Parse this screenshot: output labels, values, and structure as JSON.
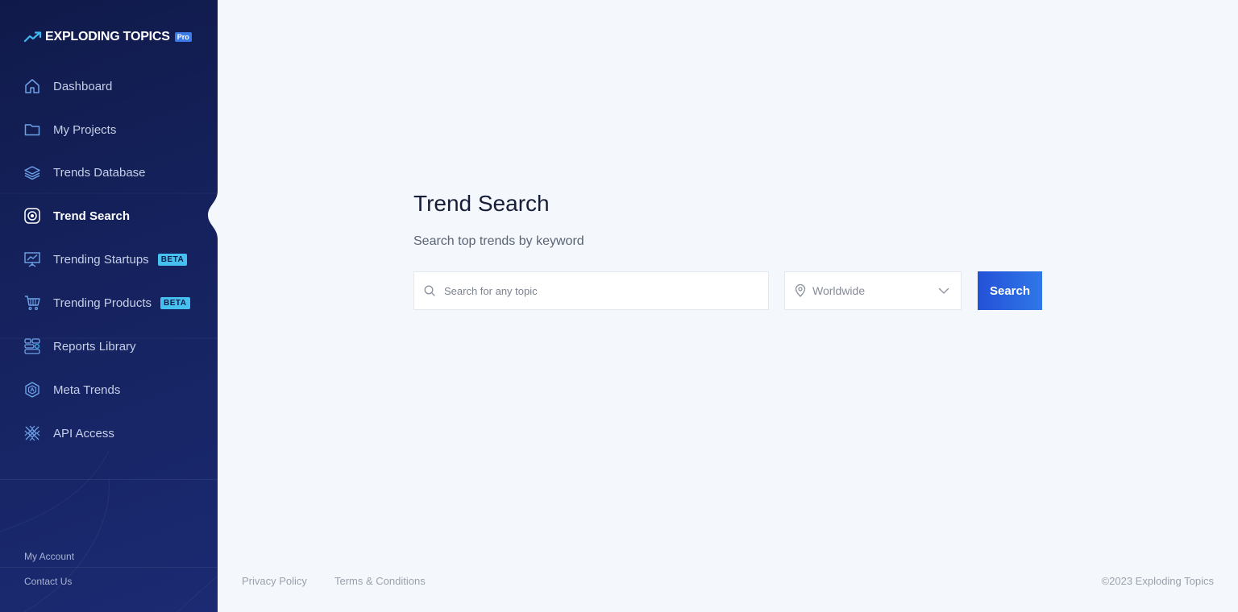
{
  "brand": {
    "name": "EXPLODING TOPICS",
    "badge": "Pro"
  },
  "sidebar": {
    "items": [
      {
        "label": "Dashboard",
        "icon": "home-icon"
      },
      {
        "label": "My Projects",
        "icon": "folder-icon"
      },
      {
        "label": "Trends Database",
        "icon": "layers-icon"
      },
      {
        "label": "Trend Search",
        "icon": "target-icon",
        "active": true
      },
      {
        "label": "Trending Startups",
        "icon": "presentation-chart-icon",
        "badge": "BETA"
      },
      {
        "label": "Trending Products",
        "icon": "cart-icon",
        "badge": "BETA"
      },
      {
        "label": "Reports Library",
        "icon": "reports-icon"
      },
      {
        "label": "Meta Trends",
        "icon": "hexagon-icon"
      },
      {
        "label": "API Access",
        "icon": "api-icon"
      }
    ],
    "bottom_links": {
      "my_account": "My Account",
      "contact_us": "Contact Us"
    }
  },
  "main": {
    "title": "Trend Search",
    "subtitle": "Search top trends by keyword",
    "search": {
      "placeholder": "Search for any topic",
      "value": ""
    },
    "location": {
      "selected": "Worldwide"
    },
    "search_button": "Search"
  },
  "footer": {
    "privacy": "Privacy Policy",
    "terms": "Terms & Conditions",
    "copyright": "©2023 Exploding Topics"
  },
  "colors": {
    "sidebar_bg": "#15225e",
    "accent": "#2451d7",
    "beta_badge": "#46c0ee",
    "page_bg": "#f4f8fc"
  }
}
